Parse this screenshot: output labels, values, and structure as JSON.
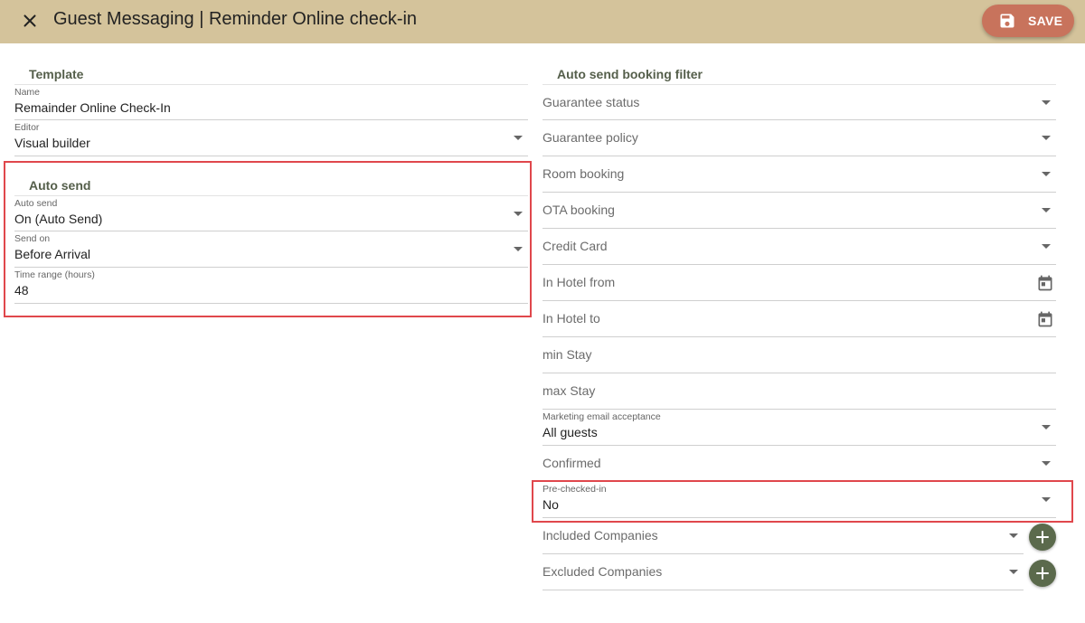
{
  "header": {
    "title": "Guest Messaging | Reminder Online check-in",
    "save_label": "SAVE",
    "background": "#d4c39b",
    "save_color": "#c8735c",
    "close_icon": "close-icon",
    "save_icon": "floppy-disk-icon"
  },
  "template": {
    "section_title": "Template",
    "name": {
      "label": "Name",
      "value": "Remainder Online Check-In"
    },
    "editor": {
      "label": "Editor",
      "value": "Visual builder"
    }
  },
  "auto_send": {
    "section_title": "Auto send",
    "auto_send": {
      "label": "Auto send",
      "value": "On (Auto Send)"
    },
    "send_on": {
      "label": "Send on",
      "value": "Before Arrival"
    },
    "time_range": {
      "label": "Time range (hours)",
      "value": "48"
    }
  },
  "filter": {
    "section_title": "Auto send booking filter",
    "guarantee_status": "Guarantee status",
    "guarantee_policy": "Guarantee policy",
    "room_booking": "Room booking",
    "ota_booking": "OTA booking",
    "credit_card": "Credit Card",
    "in_hotel_from": "In Hotel from",
    "in_hotel_to": "In Hotel to",
    "min_stay": "min Stay",
    "max_stay": "max Stay",
    "marketing": {
      "label": "Marketing email acceptance",
      "value": "All guests"
    },
    "confirmed": "Confirmed",
    "pre_checked_in": {
      "label": "Pre-checked-in",
      "value": "No"
    },
    "included_companies": "Included Companies",
    "excluded_companies": "Excluded Companies"
  },
  "colors": {
    "accent_green": "#5b6a4c",
    "highlight_red": "#e0474c",
    "section_title": "#555f4b"
  }
}
